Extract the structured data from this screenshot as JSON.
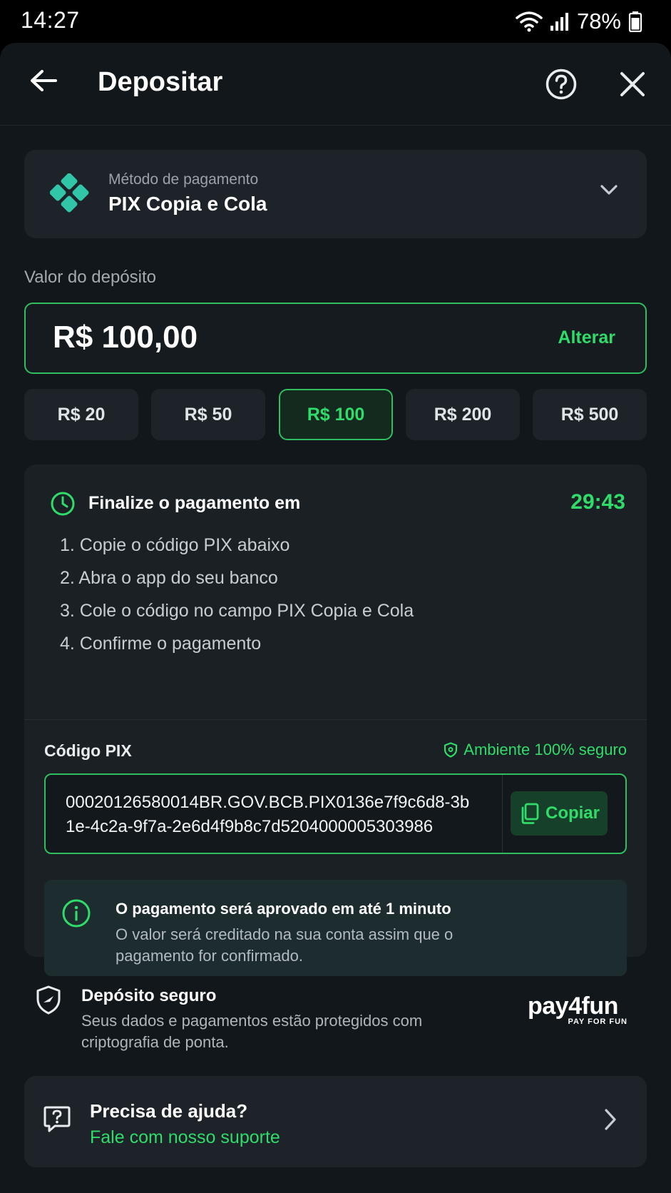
{
  "status_bar": {
    "time": "14:27",
    "battery": "78%"
  },
  "header": {
    "title": "Depositar"
  },
  "payment_method": {
    "label": "Método de pagamento",
    "name": "PIX Copia e Cola"
  },
  "deposit": {
    "label": "Valor do depósito",
    "amount": "R$ 100,00",
    "change_label": "Alterar",
    "presets": [
      "R$ 20",
      "R$ 50",
      "R$ 100",
      "R$ 200",
      "R$ 500"
    ],
    "selected_preset": "R$ 100"
  },
  "payment": {
    "finalize_label": "Finalize o pagamento em",
    "timer": "29:43",
    "steps": [
      "1. Copie o código PIX abaixo",
      "2. Abra o app do seu banco",
      "3. Cole o código no campo PIX Copia e Cola",
      "4. Confirme o pagamento"
    ],
    "code_label": "Código PIX",
    "secure_label": "Ambiente 100% seguro",
    "code": "00020126580014BR.GOV.BCB.PIX0136e7f9c6d8-3b1e-4c2a-9f7a-2e6d4f9b8c7d5204000005303986",
    "copy_label": "Copiar",
    "info_title": "O pagamento será aprovado em até 1 minuto",
    "info_body": "O valor será creditado na sua conta assim que o pagamento for confirmado."
  },
  "secure_deposit": {
    "title": "Depósito seguro",
    "body": "Seus dados e pagamentos estão protegidos com criptografia de ponta.",
    "brand": "pay4fun",
    "brand_tagline": "PAY FOR FUN"
  },
  "help": {
    "title": "Precisa de ajuda?",
    "link": "Fale com nosso suporte"
  },
  "colors": {
    "accent": "#2fdc6a",
    "background": "#12171b",
    "card": "#1d2328"
  },
  "icons": [
    "back-arrow-icon",
    "question-circle-icon",
    "close-icon",
    "pix-icon",
    "chevron-down-icon",
    "clock-icon",
    "shield-check-icon",
    "copy-icon",
    "info-icon",
    "shield-icon",
    "chat-question-icon",
    "chevron-right-icon",
    "wifi-icon",
    "signal-icon",
    "battery-icon"
  ]
}
